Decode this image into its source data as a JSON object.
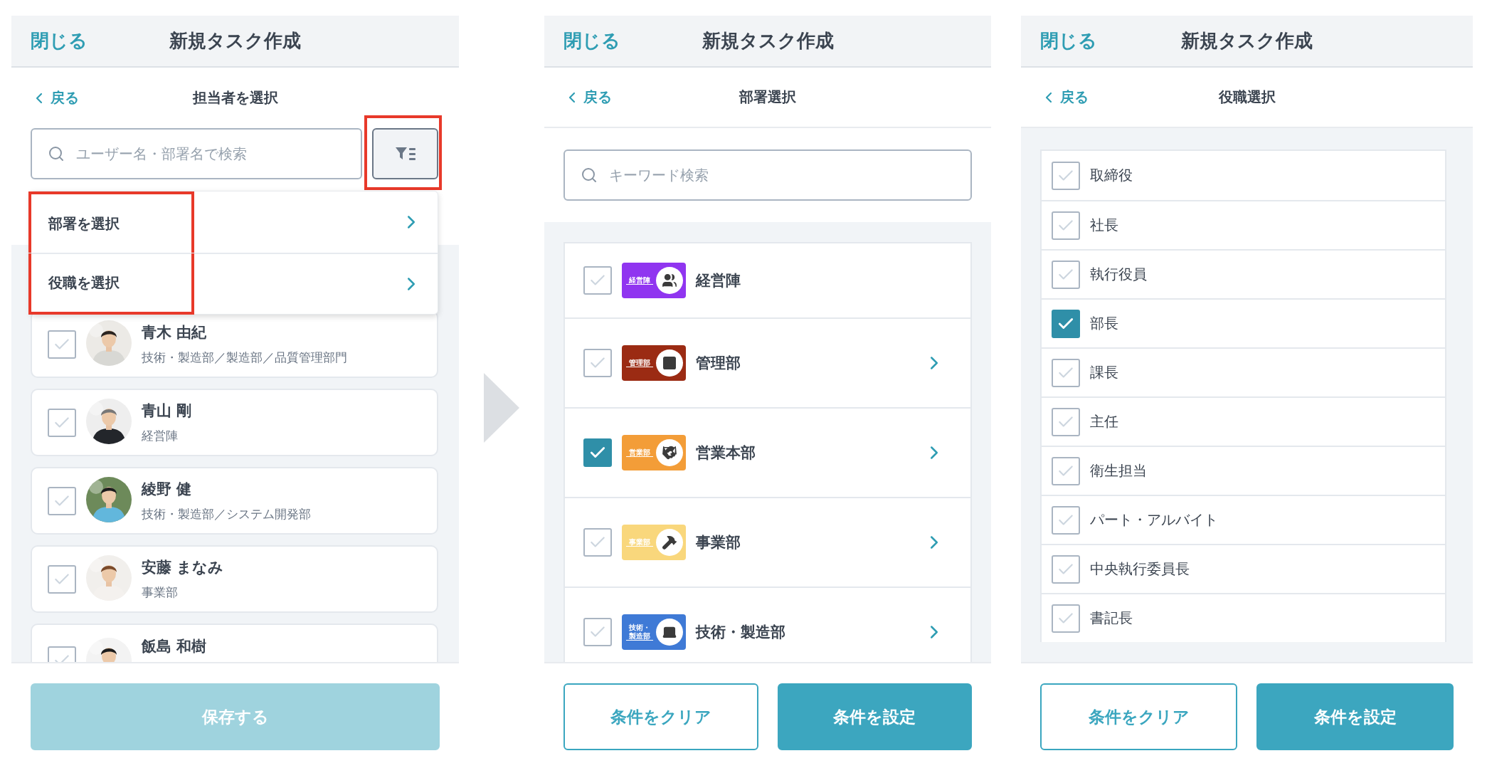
{
  "screens": [
    {
      "kind": "members",
      "header": {
        "close": "閉じる",
        "title": "新規タスク作成"
      },
      "subheader": {
        "back": "戻る",
        "title": "担当者を選択"
      },
      "search": {
        "placeholder": "ユーザー名・部署名で検索"
      },
      "filter_button": {
        "highlighted": true
      },
      "menu": {
        "highlighted": true,
        "items": [
          {
            "label": "部署を選択"
          },
          {
            "label": "役職を選択"
          }
        ]
      },
      "members": [
        {
          "name": "青木 由紀",
          "department": "技術・製造部／製造部／品質管理部門",
          "checked": false
        },
        {
          "name": "青山 剛",
          "department": "経営陣",
          "checked": false
        },
        {
          "name": "綾野 健",
          "department": "技術・製造部／システム開発部",
          "checked": false
        },
        {
          "name": "安藤 まなみ",
          "department": "事業部",
          "checked": false
        },
        {
          "name": "飯島 和樹",
          "checked": false
        }
      ],
      "buttons": [
        {
          "label": "保存する",
          "kind": "primary",
          "disabled": true
        }
      ]
    },
    {
      "kind": "departments",
      "header": {
        "close": "閉じる",
        "title": "新規タスク作成"
      },
      "subheader": {
        "back": "戻る",
        "title": "部署選択"
      },
      "search": {
        "placeholder": "キーワード検索"
      },
      "departments": [
        {
          "name": "経営陣",
          "badge": "経営陣",
          "color": "#9035f0",
          "checked": false,
          "has_children": false
        },
        {
          "name": "管理部",
          "badge": "管理部",
          "color": "#9b2b13",
          "checked": false,
          "has_children": true
        },
        {
          "name": "営業本部",
          "badge": "営業部",
          "color": "#f39d38",
          "checked": true,
          "has_children": true
        },
        {
          "name": "事業部",
          "badge": "事業部",
          "color": "#f9d77c",
          "checked": false,
          "has_children": true
        },
        {
          "name": "技術・製造部",
          "badge": "技術・製造部",
          "color": "#3f7ad6",
          "checked": false,
          "has_children": true
        }
      ],
      "buttons": [
        {
          "label": "条件をクリア",
          "kind": "outline",
          "disabled": false
        },
        {
          "label": "条件を設定",
          "kind": "primary",
          "disabled": false
        }
      ]
    },
    {
      "kind": "positions",
      "header": {
        "close": "閉じる",
        "title": "新規タスク作成"
      },
      "subheader": {
        "back": "戻る",
        "title": "役職選択"
      },
      "positions": [
        {
          "name": "取締役",
          "checked": false
        },
        {
          "name": "社長",
          "checked": false
        },
        {
          "name": "執行役員",
          "checked": false
        },
        {
          "name": "部長",
          "checked": true
        },
        {
          "name": "課長",
          "checked": false
        },
        {
          "name": "主任",
          "checked": false
        },
        {
          "name": "衛生担当",
          "checked": false
        },
        {
          "name": "パート・アルバイト",
          "checked": false
        },
        {
          "name": "中央執行委員長",
          "checked": false
        },
        {
          "name": "書記長",
          "checked": false
        }
      ],
      "buttons": [
        {
          "label": "条件をクリア",
          "kind": "outline",
          "disabled": false
        },
        {
          "label": "条件を設定",
          "kind": "primary",
          "disabled": false
        }
      ]
    }
  ]
}
